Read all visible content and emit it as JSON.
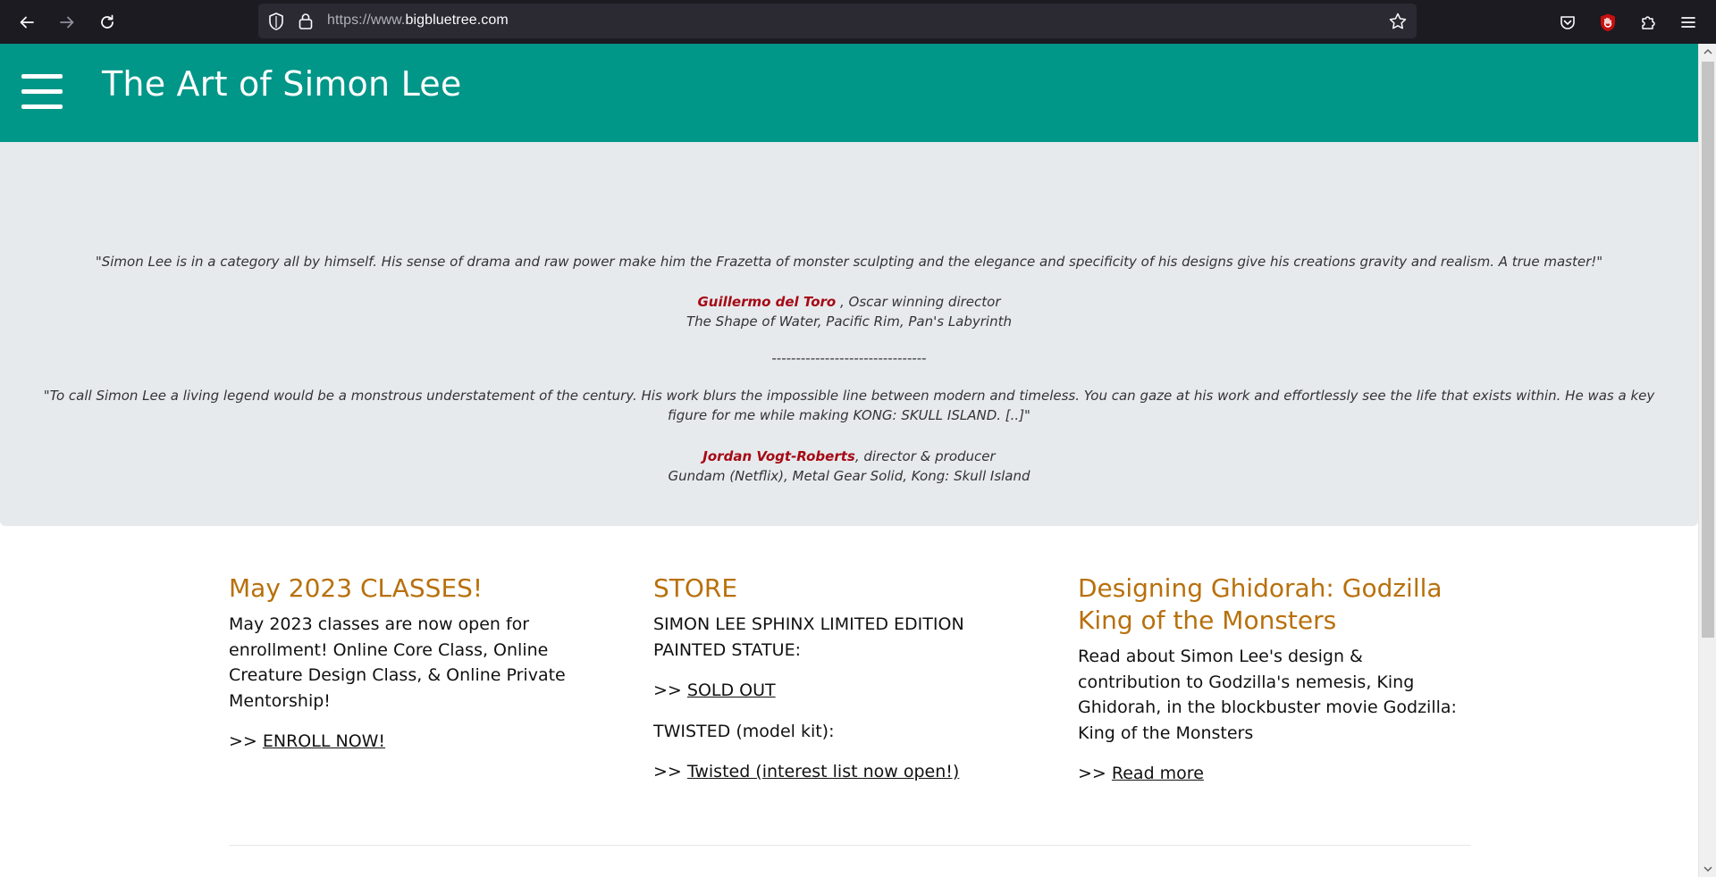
{
  "browser": {
    "url_prefix": "https://www.",
    "url_domain": "bigbluetree.com"
  },
  "site": {
    "title": "The Art of Simon Lee"
  },
  "quotes": [
    {
      "text": "\"Simon Lee is in a category all by himself. His sense of drama and raw power make him the Frazetta of monster sculpting and the elegance and specificity of his designs give his creations gravity and realism. A true master!\"",
      "author": "Guillermo del Toro",
      "role": " , Oscar winning director",
      "credits": "The Shape of Water, Pacific Rim, Pan's Labyrinth"
    },
    {
      "text": "\"To call Simon Lee a living legend would be a monstrous understatement of the century. His work blurs the impossible line between modern and timeless. You can gaze at his work and effortlessly see the life that exists within. He was a key figure for me while making KONG: SKULL ISLAND. [..]\"",
      "author": "Jordan Vogt-Roberts",
      "role": ", director & producer",
      "credits": "Gundam (Netflix), Metal Gear Solid, Kong: Skull Island"
    }
  ],
  "separator": "--------------------------------",
  "columns": {
    "classes": {
      "heading": "May 2023 CLASSES!",
      "body": "May 2023 classes are now open for enrollment! Online Core Class, Online Creature Design Class, & Online Private Mentorship!",
      "prefix": ">> ",
      "link": "ENROLL NOW!"
    },
    "store": {
      "heading": "STORE",
      "item1": "SIMON LEE SPHINX LIMITED EDITION PAINTED STATUE:",
      "prefix1": ">> ",
      "link1": "SOLD OUT",
      "item2": "TWISTED (model kit):",
      "prefix2": ">> ",
      "link2": "Twisted (interest list now open!)"
    },
    "ghidorah": {
      "heading": "Designing Ghidorah: Godzilla King of the Monsters",
      "body": "Read about Simon Lee's design & contribution to Godzilla's nemesis, King Ghidorah, in the blockbuster movie Godzilla: King of the Monsters",
      "prefix": ">> ",
      "link": "Read more"
    }
  },
  "colors": {
    "header_bg": "#009688",
    "quote_bg": "#e7eaed",
    "author_red": "#a50a15",
    "heading_orange": "#b8700c"
  }
}
